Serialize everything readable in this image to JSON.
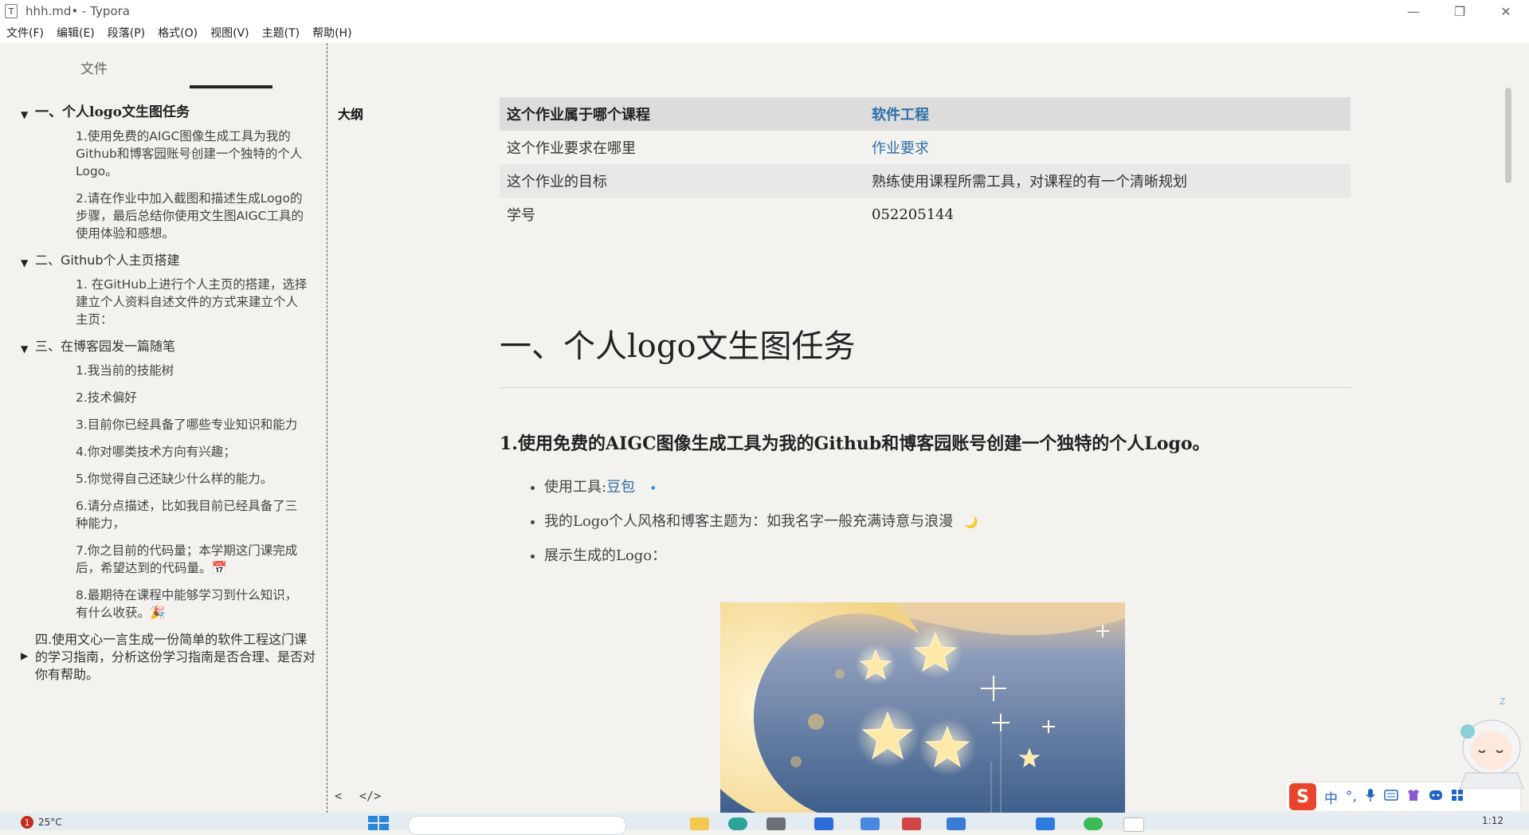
{
  "window": {
    "title": "hhh.md• - Typora",
    "app_icon_letter": "T",
    "controls": {
      "minimize": "—",
      "maximize": "❐",
      "close": "✕"
    }
  },
  "menu": [
    "文件(F)",
    "编辑(E)",
    "段落(P)",
    "格式(O)",
    "视图(V)",
    "主题(T)",
    "帮助(H)"
  ],
  "sidebar": {
    "tabs": {
      "files": "文件",
      "outline": "大纲"
    },
    "outline": [
      {
        "level": 1,
        "text": "一、个人logo文生图任务",
        "expanded": true,
        "main": true
      },
      {
        "level": 2,
        "text": "1.使用免费的AIGC图像生成工具为我的Github和博客园账号创建一个独特的个人Logo。"
      },
      {
        "level": 2,
        "text": "2.请在作业中加入截图和描述生成Logo的步骤，最后总结你使用文生图AIGC工具的使用体验和感想。"
      },
      {
        "level": 1,
        "text": "二、Github个人主页搭建",
        "expanded": true
      },
      {
        "level": 2,
        "text": "1. 在GitHub上进行个人主页的搭建，选择建立个人资料自述文件的方式来建立个人主页："
      },
      {
        "level": 1,
        "text": "三、在博客园发一篇随笔",
        "expanded": true
      },
      {
        "level": 2,
        "text": "1.我当前的技能树"
      },
      {
        "level": 2,
        "text": "2.技术偏好"
      },
      {
        "level": 2,
        "text": "3.目前你已经具备了哪些专业知识和能力"
      },
      {
        "level": 2,
        "text": "4.你对哪类技术方向有兴趣；"
      },
      {
        "level": 2,
        "text": "5.你觉得自己还缺少什么样的能力。"
      },
      {
        "level": 2,
        "text": "6.请分点描述，比如我目前已经具备了三种能力，"
      },
      {
        "level": 2,
        "text": "7.你之目前的代码量；本学期这门课完成后，希望达到的代码量。📅"
      },
      {
        "level": 2,
        "text": "8.最期待在课程中能够学习到什么知识，有什么收获。🎉"
      },
      {
        "level": 1,
        "text": "四.使用文心一言生成一份简单的软件工程这门课的学习指南，分析这份学习指南是否合理、是否对你有帮助。",
        "expanded": false
      }
    ],
    "footer": {
      "back": "<",
      "source": "</>"
    }
  },
  "document": {
    "table": [
      [
        "这个作业属于哪个课程",
        "软件工程"
      ],
      [
        "这个作业要求在哪里",
        "作业要求"
      ],
      [
        "这个作业的目标",
        "熟练使用课程所需工具，对课程的有一个清晰规划"
      ],
      [
        "学号",
        "052205144"
      ]
    ],
    "h1": "一、个人logo文生图任务",
    "h3": "1.使用免费的AIGC图像生成工具为我的Github和博客园账号创建一个独特的个人Logo。",
    "bullets": {
      "tool_label": "使用工具:",
      "tool_link": "豆包",
      "tool_emoji": "🔹",
      "style": "我的Logo个人风格和博客主题为：如我名字一般充满诗意与浪漫",
      "style_emoji": "🌙",
      "show": "展示生成的Logo："
    }
  },
  "taskbar": {
    "weather": "25°C",
    "notification_count": "1",
    "time": "1:12"
  },
  "ime": {
    "logo": "S",
    "mode": "中",
    "punct": "°,"
  }
}
